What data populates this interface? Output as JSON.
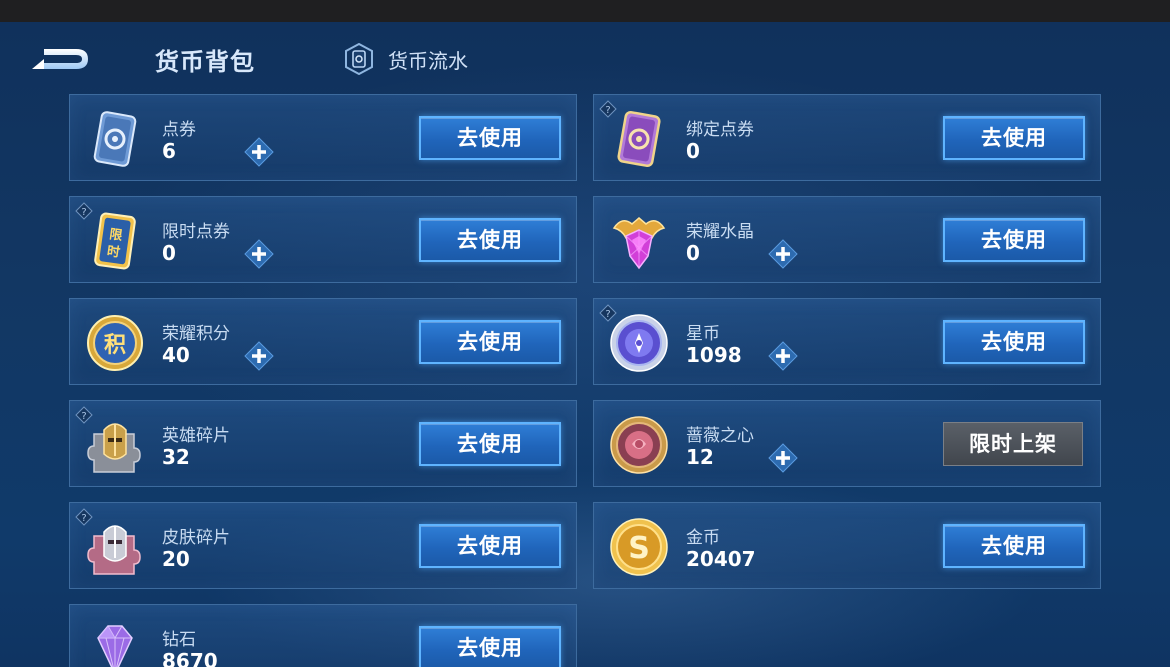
{
  "header": {
    "title": "货币背包",
    "flow_label": "货币流水"
  },
  "currencies": [
    {
      "name": "点券",
      "value": "6",
      "action": "去使用",
      "icon": "coupon-ticket-icon"
    },
    {
      "name": "绑定点券",
      "value": "0",
      "action": "去使用",
      "icon": "bound-coupon-icon"
    },
    {
      "name": "限时点券",
      "value": "0",
      "action": "去使用",
      "icon": "limited-coupon-icon",
      "icon_text": "限时"
    },
    {
      "name": "荣耀水晶",
      "value": "0",
      "action": "去使用",
      "icon": "glory-crystal-icon"
    },
    {
      "name": "荣耀积分",
      "value": "40",
      "action": "去使用",
      "icon": "glory-points-icon",
      "icon_text": "积"
    },
    {
      "name": "星币",
      "value": "1098",
      "action": "去使用",
      "icon": "star-coin-icon"
    },
    {
      "name": "英雄碎片",
      "value": "32",
      "action": "去使用",
      "icon": "hero-fragment-icon"
    },
    {
      "name": "蔷薇之心",
      "value": "12",
      "action": "限时上架",
      "icon": "rose-heart-icon"
    },
    {
      "name": "皮肤碎片",
      "value": "20",
      "action": "去使用",
      "icon": "skin-fragment-icon"
    },
    {
      "name": "金币",
      "value": "20407",
      "action": "去使用",
      "icon": "gold-coin-icon"
    },
    {
      "name": "钻石",
      "value": "8670",
      "action": "去使用",
      "icon": "diamond-icon"
    }
  ],
  "colors": {
    "background": "#123763",
    "card_border": "#3d6b9e",
    "button_blue": "#2065bb",
    "button_border": "#5fb4ff",
    "limited_button": "#41464d"
  }
}
